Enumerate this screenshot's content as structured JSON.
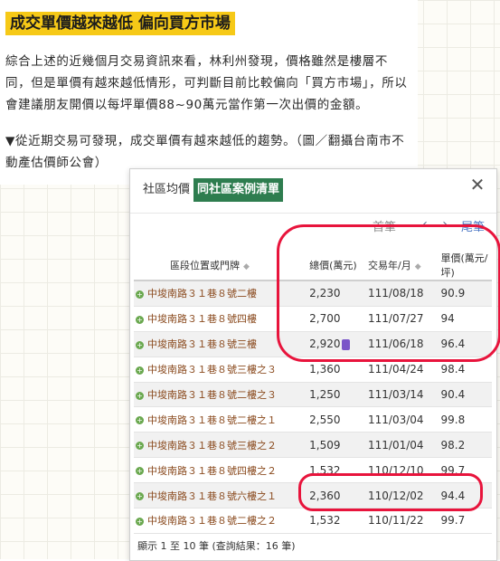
{
  "article": {
    "heading": "成交單價越來越低 偏向買方市場",
    "paragraph1": "綜合上述的近幾個月交易資訊來看，林利州發現，價格雖然是樓層不同，但是單價有越來越低情形，可判斷目前比較偏向「買方市場」，所以會建議朋友開價以每坪單價88~90萬元當作第一次出價的金額。",
    "paragraph2": "▼從近期交易可發現，成交單價有越來越低的趨勢。（圖／翻攝台南市不動產估價師公會）"
  },
  "modal": {
    "tab_avg": "社區均價",
    "tab_cases": "同社區案例清單",
    "close_icon": "✕",
    "pager": {
      "first": "首筆",
      "prev": "‹",
      "next": "›",
      "last": "尾筆"
    },
    "headers": {
      "location": "區段位置或門牌",
      "total": "總價(萬元)",
      "date": "交易年/月",
      "unit": "單價(萬元/坪)"
    },
    "rows": [
      {
        "location": "中埈南路３１巷８號二樓",
        "total": "2,230",
        "date": "111/08/18",
        "unit": "90.9",
        "badge": false
      },
      {
        "location": "中埈南路３１巷８號四樓",
        "total": "2,700",
        "date": "111/07/27",
        "unit": "94",
        "badge": false
      },
      {
        "location": "中埈南路３１巷８號三樓",
        "total": "2,920",
        "date": "111/06/18",
        "unit": "96.4",
        "badge": true
      },
      {
        "location": "中埈南路３１巷８號三樓之３",
        "total": "1,360",
        "date": "111/04/24",
        "unit": "98.4",
        "badge": false
      },
      {
        "location": "中埈南路３１巷８號二樓之３",
        "total": "1,250",
        "date": "111/03/14",
        "unit": "90.4",
        "badge": false
      },
      {
        "location": "中埈南路３１巷８號二樓之１",
        "total": "2,550",
        "date": "111/03/04",
        "unit": "99.8",
        "badge": false
      },
      {
        "location": "中埈南路３１巷８號三樓之２",
        "total": "1,509",
        "date": "111/01/04",
        "unit": "98.2",
        "badge": false
      },
      {
        "location": "中埈南路３１巷８號四樓之２",
        "total": "1,532",
        "date": "110/12/10",
        "unit": "99.7",
        "badge": false
      },
      {
        "location": "中埈南路３１巷８號六樓之１",
        "total": "2,360",
        "date": "110/12/02",
        "unit": "94.4",
        "badge": false
      },
      {
        "location": "中埈南路３１巷８號二樓之２",
        "total": "1,532",
        "date": "110/11/22",
        "unit": "99.7",
        "badge": false
      }
    ],
    "footer": "顯示 1 至 10 筆 (查詢結果：16 筆)"
  },
  "colors": {
    "highlight": "#f6c917",
    "tab_active": "#2e7d4f",
    "annotation": "#e8143c"
  }
}
